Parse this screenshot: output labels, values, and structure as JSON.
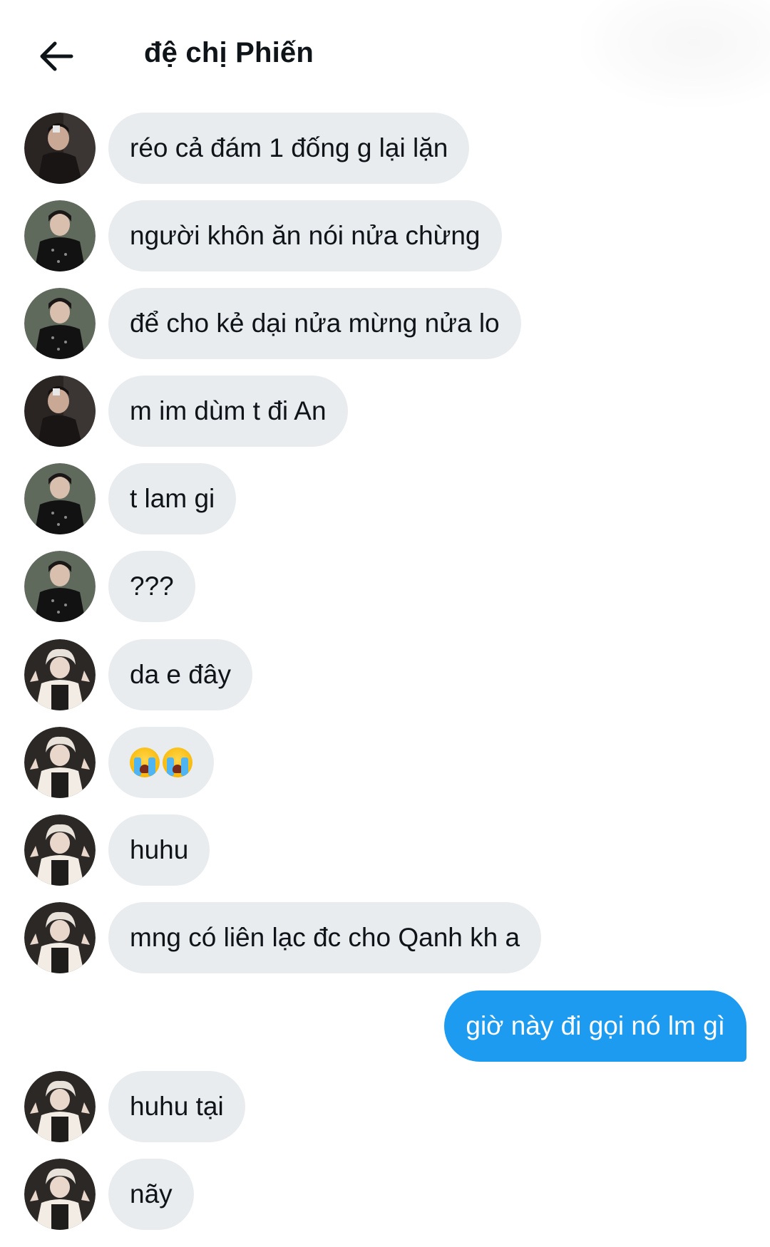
{
  "header": {
    "title": "đệ chị Phiến",
    "back_icon": "arrow-left-icon"
  },
  "colors": {
    "incoming_bubble": "#e9ecef",
    "outgoing_bubble": "#1d9bf0",
    "text": "#0f1419"
  },
  "messages": [
    {
      "sender": "A",
      "text": "réo cả đám 1 đống g lại lặn"
    },
    {
      "sender": "B",
      "text": "người khôn ăn nói nửa chừng"
    },
    {
      "sender": "B",
      "text": "để cho kẻ dại nửa mừng nửa lo"
    },
    {
      "sender": "A",
      "text": "m im dùm t đi An"
    },
    {
      "sender": "B",
      "text": "t lam gi"
    },
    {
      "sender": "B",
      "text": "???"
    },
    {
      "sender": "C",
      "text": "da e đây"
    },
    {
      "sender": "C",
      "text": "",
      "emoji": "loudly-crying-face x2"
    },
    {
      "sender": "C",
      "text": "huhu"
    },
    {
      "sender": "C",
      "text": "mng có liên lạc đc cho Qanh kh a"
    },
    {
      "sender": "me",
      "text": "giờ này đi gọi nó lm gì"
    },
    {
      "sender": "C",
      "text": "huhu tại"
    },
    {
      "sender": "C",
      "text": "nãy"
    }
  ]
}
